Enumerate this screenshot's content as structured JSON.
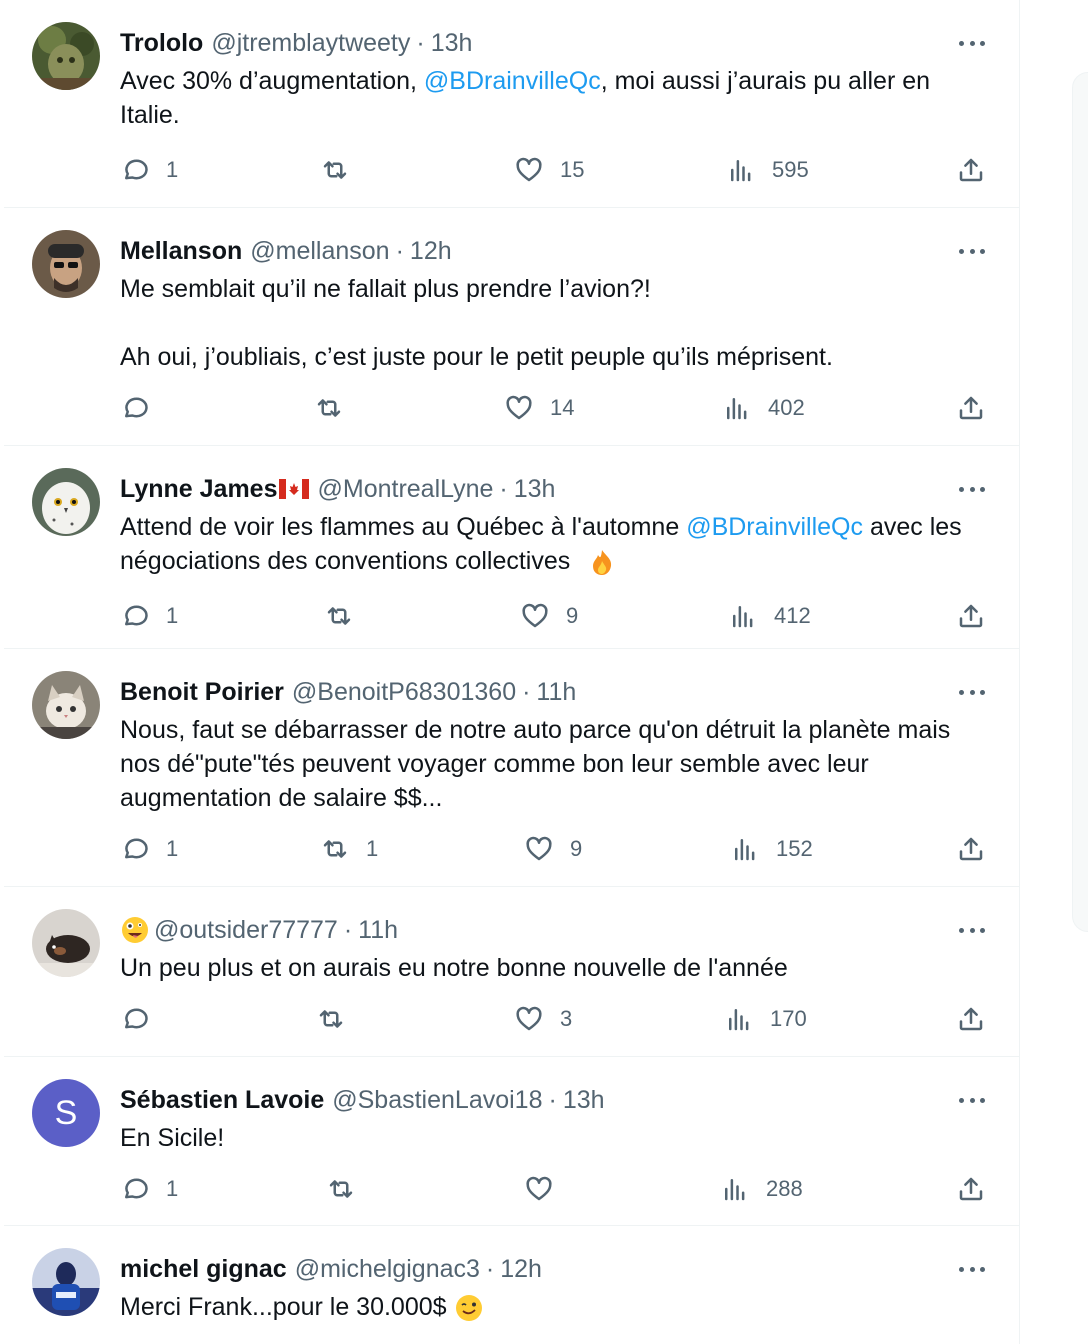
{
  "tweets": [
    {
      "name": "Trololo",
      "handle": "@jtremblaytweety",
      "time": "13h",
      "text_parts": [
        {
          "t": "Avec 30% d’augmentation, ",
          "mention": false
        },
        {
          "t": "@BDrainvilleQc",
          "mention": true
        },
        {
          "t": ", moi aussi j’aurais pu aller en Italie.",
          "mention": false
        }
      ],
      "replies": "1",
      "retweets": "",
      "likes": "15",
      "views": "595",
      "avatar_icon": "moss-sculpture-avatar"
    },
    {
      "name": "Mellanson",
      "handle": "@mellanson",
      "time": "12h",
      "line1": "Me semblait qu’il ne fallait plus prendre l’avion?!",
      "line2": "Ah oui, j’oubliais, c’est juste pour le petit peuple qu’ils méprisent.",
      "replies": "",
      "retweets": "",
      "likes": "14",
      "views": "402",
      "avatar_icon": "man-with-cap-avatar"
    },
    {
      "name": "Lynne James",
      "handle": "@MontrealLyne",
      "time": "13h",
      "text_parts": [
        {
          "t": "Attend de voir les flammes au Québec à l'automne ",
          "mention": false
        },
        {
          "t": "@BDrainvilleQc",
          "mention": true
        },
        {
          "t": " avec les négociations des conventions collectives",
          "mention": false
        }
      ],
      "replies": "1",
      "retweets": "",
      "likes": "9",
      "views": "412",
      "avatar_icon": "snowy-owl-avatar"
    },
    {
      "name": "Benoit Poirier",
      "handle": "@BenoitP68301360",
      "time": "11h",
      "text": "Nous, faut se débarrasser de notre auto parce qu'on détruit la planète mais nos dé\"pute\"tés peuvent voyager comme bon leur semble avec leur augmentation de salaire $$...",
      "replies": "1",
      "retweets": "1",
      "likes": "9",
      "views": "152",
      "avatar_icon": "cat-avatar"
    },
    {
      "name": "",
      "handle": "@outsider77777",
      "time": "11h",
      "text": "Un peu plus et on aurais eu notre bonne nouvelle de l'année",
      "replies": "",
      "retweets": "",
      "likes": "3",
      "views": "170",
      "avatar_icon": "dog-avatar"
    },
    {
      "name": "Sébastien Lavoie",
      "handle": "@SbastienLavoi18",
      "time": "13h",
      "text": "En Sicile!",
      "avatar_letter": "S",
      "replies": "1",
      "retweets": "",
      "likes": "",
      "views": "288"
    },
    {
      "name": "michel gignac",
      "handle": "@michelgignac3",
      "time": "12h",
      "text": "Merci Frank...pour le 30.000$",
      "avatar_icon": "blue-figure-avatar"
    }
  ],
  "colors": {
    "accent": "#1d9bf0",
    "muted": "#536471",
    "text": "#0f1419",
    "border": "#eff3f4"
  }
}
